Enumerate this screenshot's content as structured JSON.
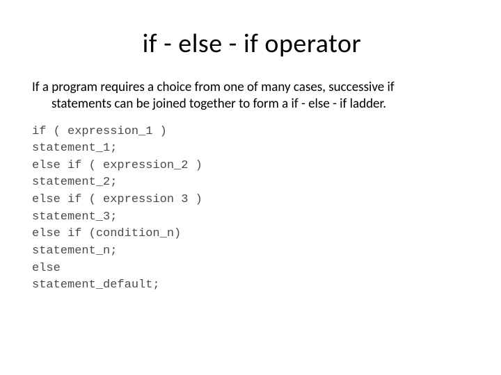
{
  "title": "if - else - if operator",
  "body": {
    "line1": "If a program requires a choice from one of many cases, successive if",
    "line2": "statements can be joined together to form a if - else - if ladder."
  },
  "code": {
    "l1": "if ( expression_1 )",
    "l2": "statement_1;",
    "l3": "else if ( expression_2 )",
    "l4": "statement_2;",
    "l5": "else if ( expression 3 )",
    "l6": "statement_3;",
    "l7": "else if (condition_n)",
    "l8": "statement_n;",
    "l9": "else",
    "l10": "statement_default;"
  }
}
